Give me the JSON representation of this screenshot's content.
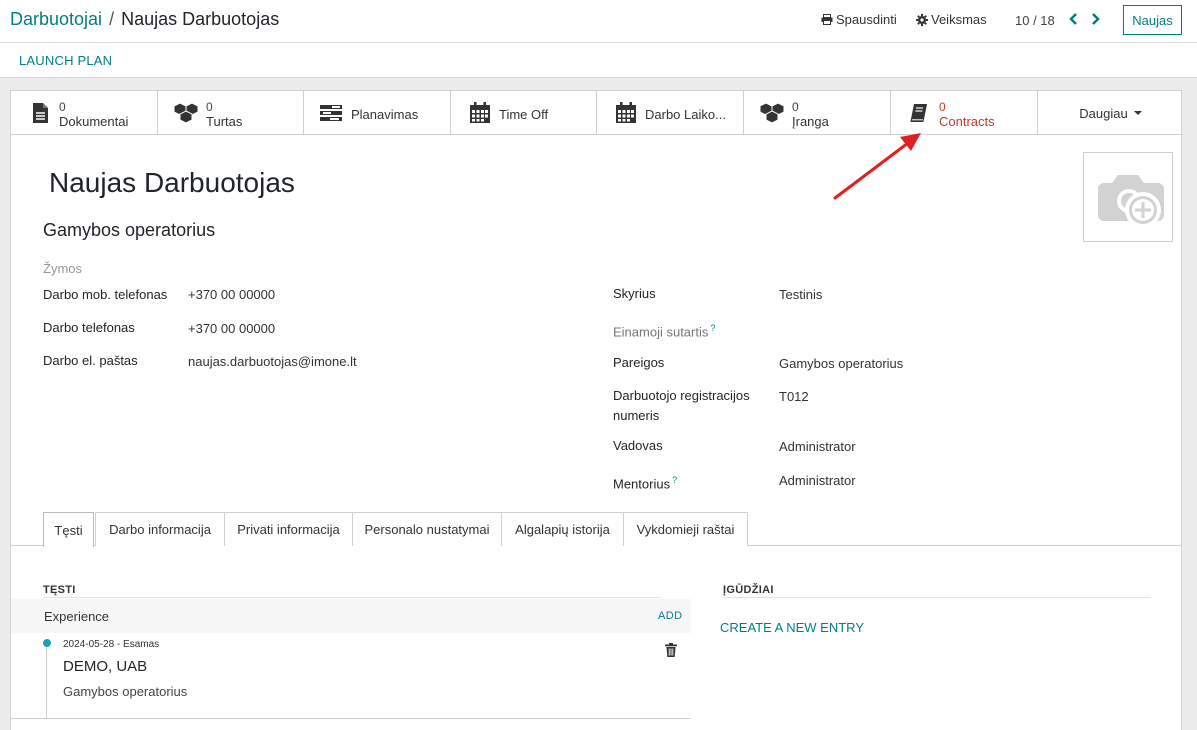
{
  "breadcrumb": {
    "parent": "Darbuotojai",
    "separator": "/",
    "current": "Naujas Darbuotojas"
  },
  "toolbar": {
    "print_label": "Spausdinti",
    "action_label": "Veiksmas",
    "pager": "10 / 18",
    "new_label": "Naujas"
  },
  "header_buttons": {
    "launch_plan": "LAUNCH PLAN"
  },
  "smart_buttons": [
    {
      "count": "0",
      "label": "Dokumentai",
      "icon": "document-icon"
    },
    {
      "count": "0",
      "label": "Turtas",
      "icon": "cubes-icon"
    },
    {
      "count": "",
      "label": "Planavimas",
      "icon": "tasks-icon"
    },
    {
      "count": "",
      "label": "Time Off",
      "icon": "calendar-icon"
    },
    {
      "count": "",
      "label": "Darbo Laiko...",
      "icon": "calendar-icon"
    },
    {
      "count": "0",
      "label": "Įranga",
      "icon": "cubes-icon"
    },
    {
      "count": "0",
      "label": "Contracts",
      "icon": "book-icon",
      "color": "#c0392b"
    }
  ],
  "more_label": "Daugiau",
  "employee": {
    "name": "Naujas Darbuotojas",
    "job_title": "Gamybos operatorius",
    "tags_placeholder": "Žymos"
  },
  "fields_left": [
    {
      "label": "Darbo mob. telefonas",
      "value": "+370 00 00000"
    },
    {
      "label": "Darbo telefonas",
      "value": "+370 00 00000"
    },
    {
      "label": "Darbo el. paštas",
      "value": "naujas.darbuotojas@imone.lt"
    }
  ],
  "fields_right": [
    {
      "label": "Skyrius",
      "value": "Testinis"
    },
    {
      "label": "Einamoji sutartis",
      "value": "",
      "hint": "?"
    },
    {
      "label": "Pareigos",
      "value": "Gamybos operatorius"
    },
    {
      "label": "Darbuotojo registracijos numeris",
      "value": "T012"
    },
    {
      "label": "Vadovas",
      "value": "Administrator"
    },
    {
      "label": "Mentorius",
      "value": "Administrator",
      "hint": "?"
    }
  ],
  "tabs": [
    "Tęsti",
    "Darbo informacija",
    "Privati informacija",
    "Personalo nustatymai",
    "Algalapių istorija",
    "Vykdomieji raštai"
  ],
  "resume": {
    "section_title": "TĘSTI",
    "group": "Experience",
    "add_label": "ADD",
    "line": {
      "date": "2024-05-28 - Esamas",
      "name": "DEMO, UAB",
      "description": "Gamybos operatorius"
    }
  },
  "skills": {
    "section_title": "ĮGŪDŽIAI",
    "create_label": "CREATE A NEW ENTRY"
  },
  "colors": {
    "accent": "#017e84",
    "contracts_red": "#c0392b",
    "annotation_arrow": "#e02020",
    "timeline_dot": "#17a2b8"
  }
}
